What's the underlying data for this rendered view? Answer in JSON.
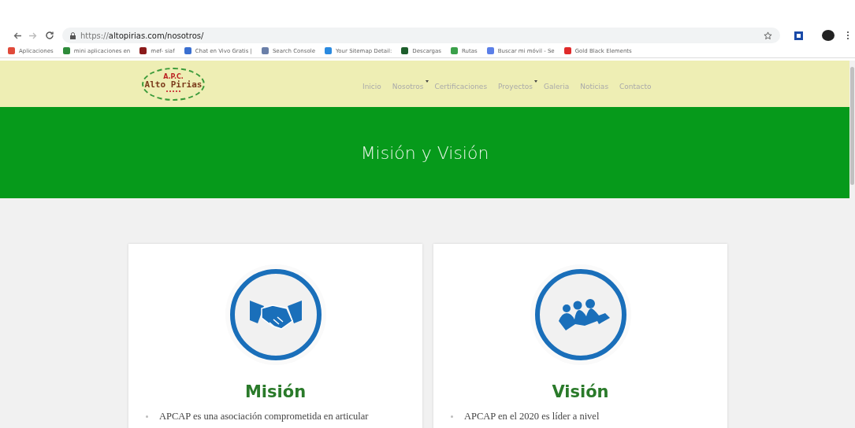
{
  "browser": {
    "url_scheme": "https://",
    "url_rest": "altopirias.com/nosotros/"
  },
  "bookmarks": [
    {
      "label": "Aplicaciones",
      "color": "#e04a3a"
    },
    {
      "label": "mini aplicaciones en",
      "color": "#2e8b3a"
    },
    {
      "label": "mef- siaf",
      "color": "#8b1a1a"
    },
    {
      "label": "Chat en Vivo Gratis |",
      "color": "#3a6fd0"
    },
    {
      "label": "Search Console",
      "color": "#6a7fa8"
    },
    {
      "label": "Your Sitemap Detail:",
      "color": "#2a8ae0"
    },
    {
      "label": "Descargas",
      "color": "#1d5e2c"
    },
    {
      "label": "Rutas",
      "color": "#3aa04a"
    },
    {
      "label": "Buscar mi móvil - Se",
      "color": "#5b7fe8"
    },
    {
      "label": "Gold Black Elements",
      "color": "#e02a2a"
    }
  ],
  "site": {
    "logo_top": "A.P.C.",
    "logo_name": "Alto Pirias",
    "nav": [
      {
        "label": "Inicio",
        "dropdown": false
      },
      {
        "label": "Nosotros",
        "dropdown": true
      },
      {
        "label": "Certificaciones",
        "dropdown": false
      },
      {
        "label": "Proyectos",
        "dropdown": true
      },
      {
        "label": "Galeria",
        "dropdown": false
      },
      {
        "label": "Noticias",
        "dropdown": false
      },
      {
        "label": "Contacto",
        "dropdown": false
      }
    ]
  },
  "hero": {
    "title": "Misión y Visión"
  },
  "cards": [
    {
      "kind": "handshake",
      "title": "Misión",
      "text": "APCAP es una asociación comprometida en articular"
    },
    {
      "kind": "team",
      "title": "Visión",
      "text": "APCAP en el 2020 es líder a nivel"
    }
  ]
}
